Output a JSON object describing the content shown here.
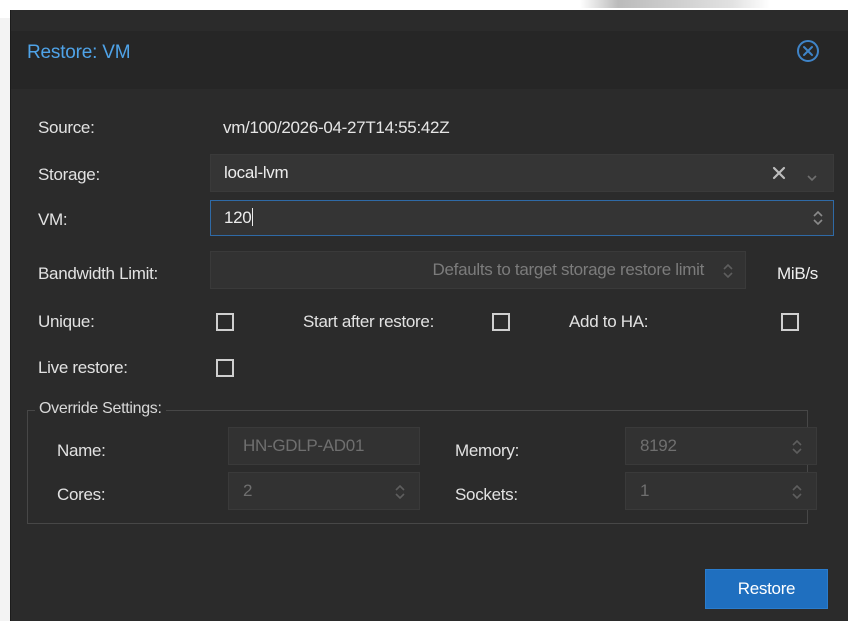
{
  "dialog": {
    "title": "Restore: VM",
    "close_icon": "close-circle-icon"
  },
  "source": {
    "label": "Source:",
    "value": "vm/100/2026-04-27T14:55:42Z"
  },
  "storage": {
    "label": "Storage:",
    "value": "local-lvm",
    "clear_icon": "clear-x-icon",
    "dropdown_icon": "chevron-down-icon"
  },
  "vm": {
    "label": "VM:",
    "value": "120"
  },
  "bandwidth": {
    "label": "Bandwidth Limit:",
    "placeholder": "Defaults to target storage restore limit",
    "unit": "MiB/s"
  },
  "unique": {
    "label": "Unique:",
    "checked": false
  },
  "start_after_restore": {
    "label": "Start after restore:",
    "checked": false
  },
  "add_to_ha": {
    "label": "Add to HA:",
    "checked": false
  },
  "live_restore": {
    "label": "Live restore:",
    "checked": false
  },
  "override": {
    "legend": "Override Settings:",
    "name": {
      "label": "Name:",
      "placeholder": "HN-GDLP-AD01"
    },
    "memory": {
      "label": "Memory:",
      "placeholder": "8192"
    },
    "cores": {
      "label": "Cores:",
      "placeholder": "2"
    },
    "sockets": {
      "label": "Sockets:",
      "placeholder": "1"
    }
  },
  "actions": {
    "restore_label": "Restore"
  },
  "colors": {
    "accent": "#4fa3e8",
    "primary_button": "#1f6fbf",
    "dialog_bg": "#2b2b2b",
    "field_bg": "#353535"
  }
}
